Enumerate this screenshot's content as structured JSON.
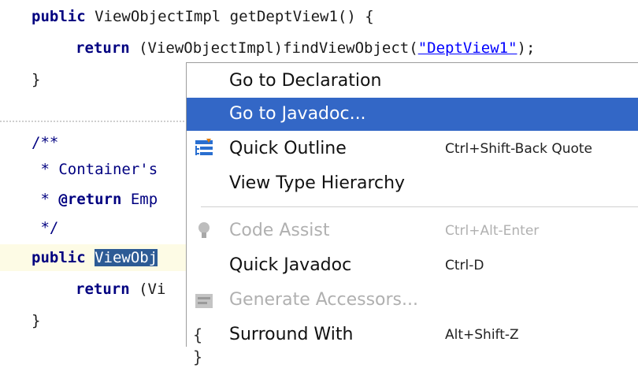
{
  "code": {
    "line1": {
      "kw": "public",
      "text": " ViewObjectImpl getDeptView1() {"
    },
    "line2": {
      "kw": "return",
      "pre": " (ViewObjectImpl)findViewObject(",
      "str": "\"DeptView1\"",
      "post": ");"
    },
    "line3": "}",
    "line4": "/**",
    "line5": " * Container's",
    "line6": {
      "pre": " * ",
      "tag": "@return",
      "post": " Emp"
    },
    "line7": " */",
    "line8": {
      "kw": "public",
      "space": " ",
      "selected": "ViewObj"
    },
    "line9": {
      "kw": "return",
      "text": " (Vi"
    },
    "line10": "}"
  },
  "context_menu": {
    "items": [
      {
        "label": "Go to Declaration",
        "shortcut": "",
        "icon": "",
        "state": "normal"
      },
      {
        "label": "Go to Javadoc...",
        "shortcut": "",
        "icon": "",
        "state": "selected"
      },
      {
        "label": "Quick Outline",
        "shortcut": "Ctrl+Shift-Back Quote",
        "icon": "quick-outline-icon",
        "state": "normal"
      },
      {
        "label": "View Type Hierarchy",
        "shortcut": "",
        "icon": "",
        "state": "normal"
      },
      {
        "label": "Code Assist",
        "shortcut": "Ctrl+Alt-Enter",
        "icon": "lightbulb-icon",
        "state": "disabled"
      },
      {
        "label": "Quick Javadoc",
        "shortcut": "Ctrl-D",
        "icon": "",
        "state": "normal"
      },
      {
        "label": "Generate Accessors...",
        "shortcut": "",
        "icon": "generate-accessors-icon",
        "state": "disabled"
      },
      {
        "label": "Surround With",
        "shortcut": "Alt+Shift-Z",
        "icon": "braces-icon",
        "state": "normal"
      }
    ]
  },
  "colors": {
    "keyword": "#000080",
    "string": "#0000ff",
    "selection": "#2d5b95",
    "menu_highlight": "#3367c6",
    "current_line": "#fdfbe5"
  }
}
